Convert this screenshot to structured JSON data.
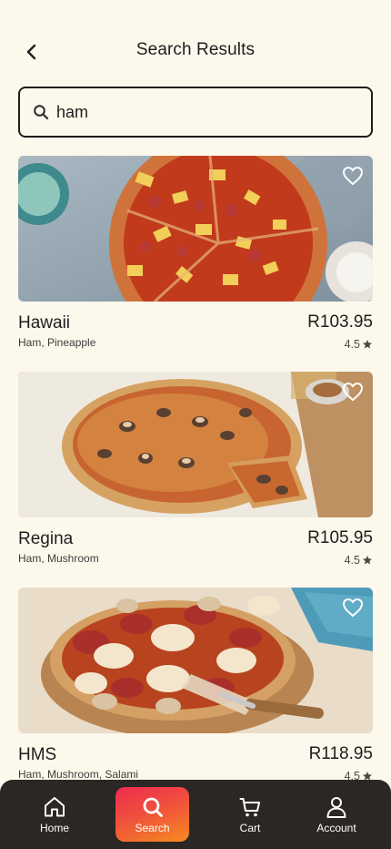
{
  "header": {
    "title": "Search Results"
  },
  "search": {
    "value": "ham",
    "placeholder": ""
  },
  "results": [
    {
      "name": "Hawaii",
      "ingredients": "Ham, Pineapple",
      "price": "R103.95",
      "rating": "4.5"
    },
    {
      "name": "Regina",
      "ingredients": "Ham, Mushroom",
      "price": "R105.95",
      "rating": "4.5"
    },
    {
      "name": "HMS",
      "ingredients": "Ham, Mushroom, Salami",
      "price": "R118.95",
      "rating": "4.5"
    }
  ],
  "nav": {
    "home": "Home",
    "search": "Search",
    "cart": "Cart",
    "account": "Account"
  },
  "icons": {
    "back": "chevron-left-icon",
    "search": "search-icon",
    "favorite": "heart-outline-icon",
    "rating": "star-icon",
    "home": "home-icon",
    "cart": "cart-icon",
    "account": "user-icon"
  },
  "colors": {
    "background": "#fdf8ec",
    "text": "#1e1e1e",
    "nav_background": "#2b2725",
    "active_gradient_start": "#ee2a4f",
    "active_gradient_end": "#f58a1f"
  }
}
